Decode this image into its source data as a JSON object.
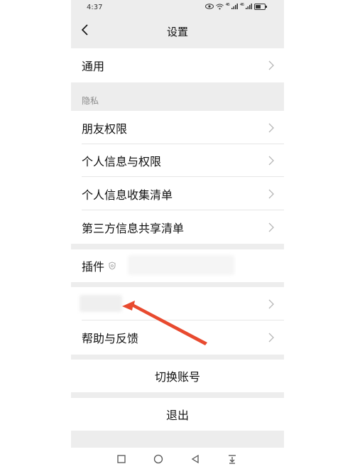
{
  "status_bar": {
    "time": "4:37",
    "signal_1": "⁴⁶",
    "signal_2": "⁴⁶"
  },
  "header": {
    "title": "设置"
  },
  "general": {
    "label": "通用"
  },
  "privacy": {
    "section_label": "隐私",
    "items": [
      {
        "label": "朋友权限"
      },
      {
        "label": "个人信息与权限"
      },
      {
        "label": "个人信息收集清单"
      },
      {
        "label": "第三方信息共享清单"
      }
    ]
  },
  "plugins": {
    "label": "插件"
  },
  "help": {
    "label": "帮助与反馈"
  },
  "actions": {
    "switch_account": "切换账号",
    "logout": "退出"
  },
  "colors": {
    "arrow": "#e84a2f",
    "background": "#ededed"
  },
  "system_nav": {
    "icons": [
      "recent-apps-icon",
      "home-icon",
      "back-icon",
      "notification-icon"
    ]
  }
}
